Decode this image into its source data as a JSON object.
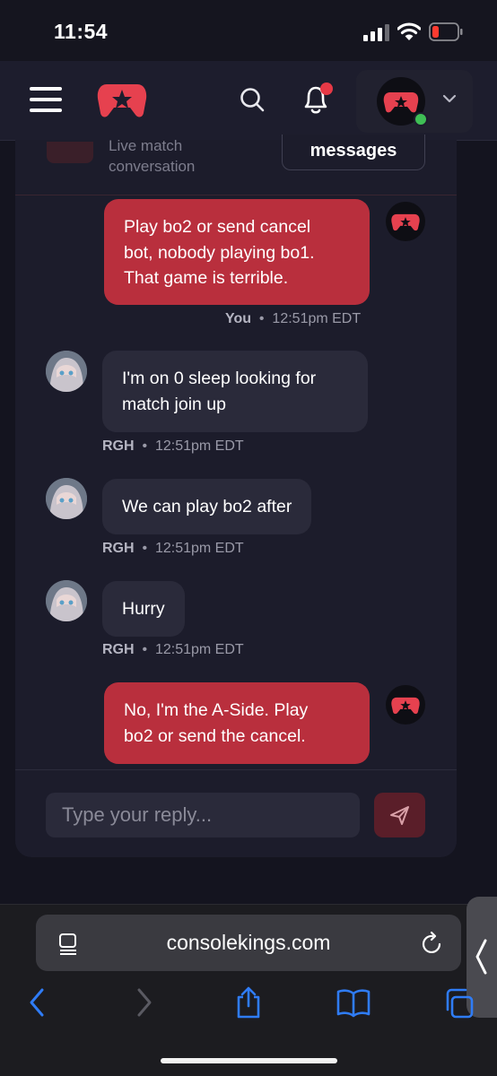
{
  "status_bar": {
    "time": "11:54"
  },
  "chat": {
    "header_subtitle_line1": "Live match",
    "header_subtitle_line2": "conversation",
    "messages_button": "messages",
    "messages": [
      {
        "sender": "You",
        "own": true,
        "lines": [
          "Play bo2 or send cancel",
          "bot, nobody playing bo1.",
          "That game is terrible."
        ],
        "time": "12:51pm EDT"
      },
      {
        "sender": "RGH",
        "own": false,
        "lines": [
          "I'm on 0 sleep looking for",
          "match join up"
        ],
        "time": "12:51pm EDT"
      },
      {
        "sender": "RGH",
        "own": false,
        "lines": [
          "We can play bo2 after"
        ],
        "time": "12:51pm EDT"
      },
      {
        "sender": "RGH",
        "own": false,
        "lines": [
          "Hurry"
        ],
        "time": "12:51pm EDT"
      },
      {
        "sender": "",
        "own": true,
        "lines": [
          "No, I'm the A-Side. Play",
          "bo2 or send the cancel."
        ],
        "time": ""
      }
    ],
    "reply_placeholder": "Type your reply..."
  },
  "browser": {
    "url": "consolekings.com"
  },
  "colors": {
    "accent": "#b92f3d",
    "background": "#14141f",
    "online": "#3fbf55"
  }
}
